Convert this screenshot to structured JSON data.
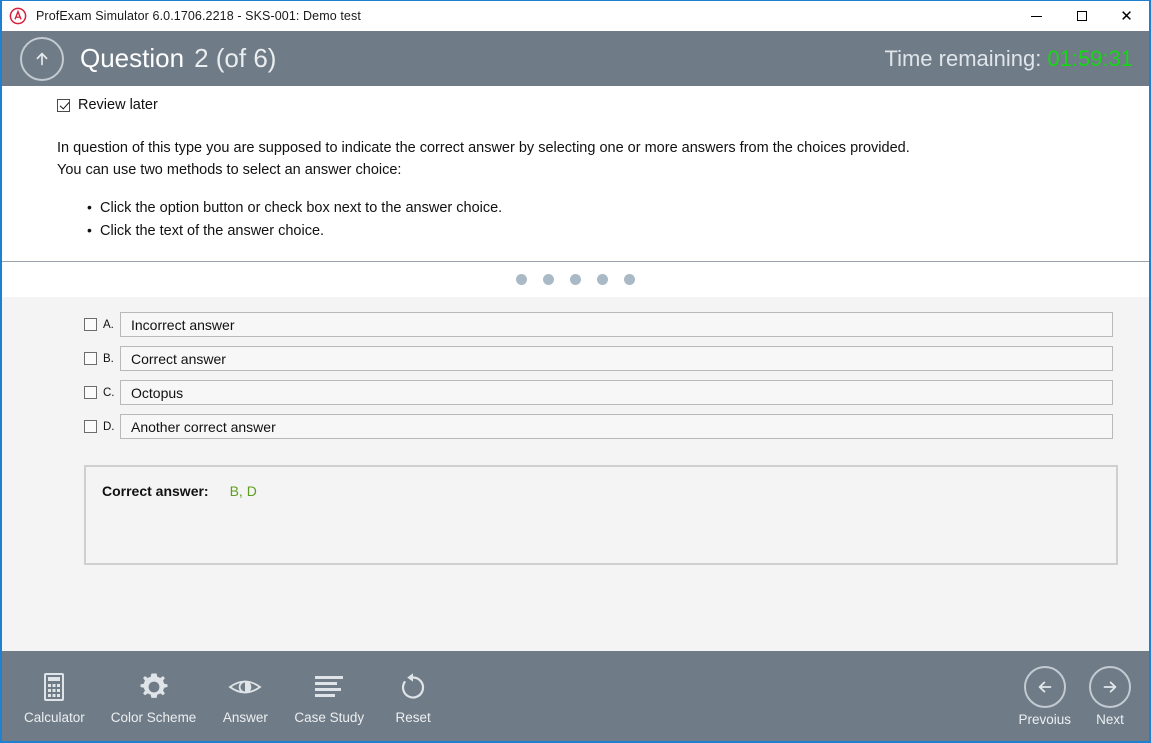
{
  "titlebar": {
    "app_icon": "profexam-logo-icon",
    "title": "ProfExam Simulator 6.0.1706.2218 - SKS-001: Demo test",
    "minimize_label": "—",
    "maximize_label": "",
    "close_label": "✕"
  },
  "header": {
    "up_icon": "arrow-up-icon",
    "question_word": "Question",
    "question_number": "2  (of 6)",
    "timer_label": "Time remaining:",
    "timer_value": "01:59:31",
    "timer_color": "#16d616",
    "background_color": "#6f7b86"
  },
  "question": {
    "review_later_label": "Review later",
    "review_later_checked": true,
    "line1": "In question of this type you are supposed to  indicate the correct answer by selecting one or more answers from the choices provided.",
    "line2": "You can use two methods to select an answer choice:",
    "bullets": [
      "Click the option button or check box next to the answer choice.",
      "Click the text of the answer choice."
    ]
  },
  "splitter": {
    "dot_count": 5,
    "dot_color": "#a9bac6"
  },
  "answers": [
    {
      "letter": "A.",
      "text": "Incorrect answer",
      "checked": false
    },
    {
      "letter": "B.",
      "text": "Correct answer",
      "checked": false
    },
    {
      "letter": "C.",
      "text": "Octopus",
      "checked": false
    },
    {
      "letter": "D.",
      "text": "Another correct answer",
      "checked": false
    }
  ],
  "explanation": {
    "label": "Correct answer:",
    "value": "B, D",
    "value_color": "#5d9e1e"
  },
  "toolbar": {
    "tools": [
      {
        "icon": "calculator-icon",
        "label": "Calculator"
      },
      {
        "icon": "gear-icon",
        "label": "Color Scheme"
      },
      {
        "icon": "eye-icon",
        "label": "Answer"
      },
      {
        "icon": "lines-icon",
        "label": "Case Study"
      },
      {
        "icon": "reset-arrow-icon",
        "label": "Reset"
      }
    ],
    "previous": {
      "icon": "arrow-left-icon",
      "label": "Prevoius"
    },
    "next": {
      "icon": "arrow-right-icon",
      "label": "Next"
    }
  }
}
